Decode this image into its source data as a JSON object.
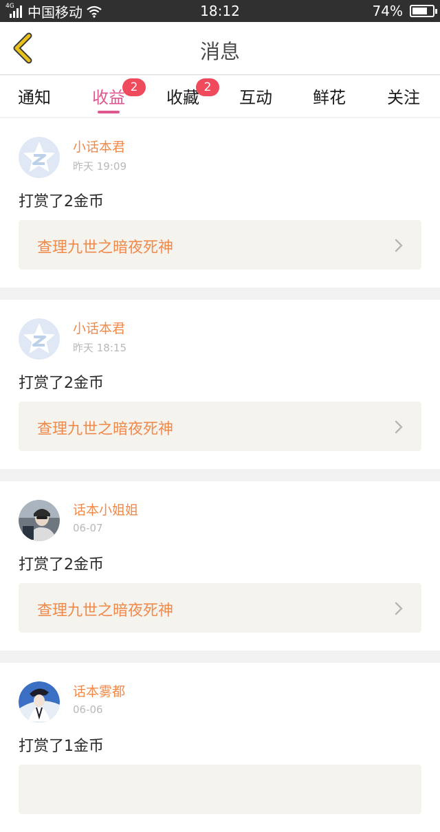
{
  "status_bar": {
    "network": "4G",
    "carrier": "中国移动",
    "time": "18:12",
    "battery_percent": "74%",
    "battery_level": 0.74
  },
  "navbar": {
    "title": "消息",
    "back_icon": "chevron-left-icon",
    "back_color": "#e8c21a"
  },
  "tabs": [
    {
      "label": "通知",
      "active": false,
      "badge": ""
    },
    {
      "label": "收益",
      "active": true,
      "badge": "2"
    },
    {
      "label": "收藏",
      "active": false,
      "badge": "2"
    },
    {
      "label": "互动",
      "active": false,
      "badge": ""
    },
    {
      "label": "鲜花",
      "active": false,
      "badge": ""
    },
    {
      "label": "关注",
      "active": false,
      "badge": ""
    }
  ],
  "messages": [
    {
      "user": "小话本君",
      "time": "昨天 19:09",
      "text": "打赏了2金币",
      "book": "查理九世之暗夜死神",
      "avatar": "star-logo-avatar"
    },
    {
      "user": "小话本君",
      "time": "昨天 18:15",
      "text": "打赏了2金币",
      "book": "查理九世之暗夜死神",
      "avatar": "star-logo-avatar"
    },
    {
      "user": "话本小姐姐",
      "time": "06-07",
      "text": "打赏了2金币",
      "book": "查理九世之暗夜死神",
      "avatar": "photo-avatar"
    },
    {
      "user": "话本雾都",
      "time": "06-06",
      "text": "打赏了1金币",
      "book": "",
      "avatar": "photo-avatar"
    }
  ],
  "colors": {
    "accent": "#e0568f",
    "badge": "#f04a5d",
    "username": "#f08a4b",
    "booklink_bg": "#f4f3ee"
  }
}
